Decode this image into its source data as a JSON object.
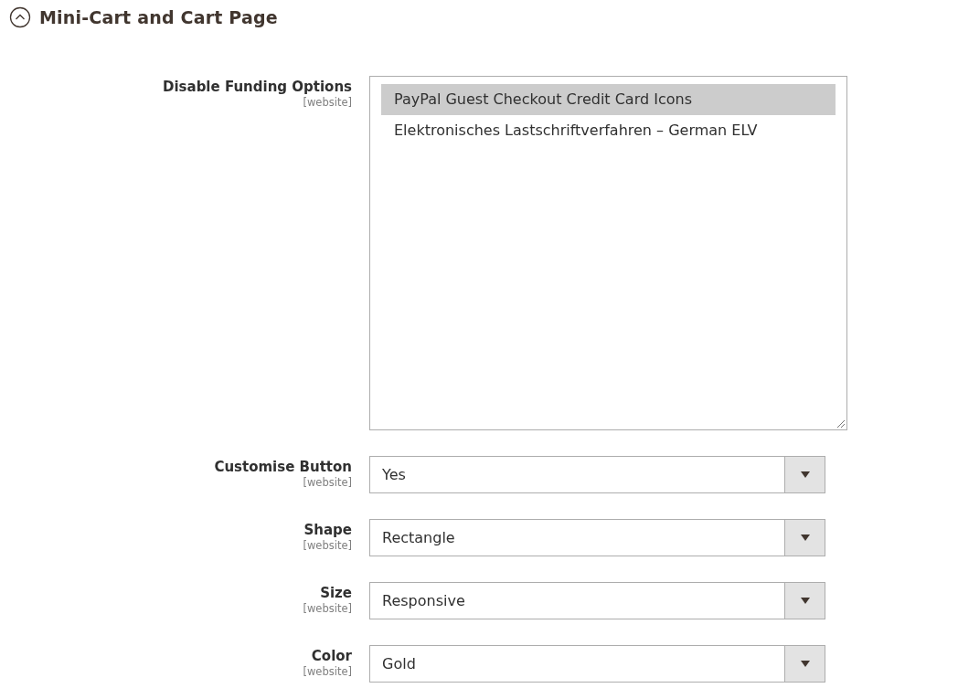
{
  "section": {
    "title": "Mini-Cart and Cart Page",
    "expanded": true
  },
  "fields": [
    {
      "kind": "multiselect",
      "label": "Disable Funding Options",
      "scope": "[website]",
      "options": [
        {
          "label": "PayPal Guest Checkout Credit Card Icons",
          "selected": true
        },
        {
          "label": "Elektronisches Lastschriftverfahren – German ELV",
          "selected": false
        }
      ]
    },
    {
      "kind": "select",
      "label": "Customise Button",
      "scope": "[website]",
      "value": "Yes"
    },
    {
      "kind": "select",
      "label": "Shape",
      "scope": "[website]",
      "value": "Rectangle"
    },
    {
      "kind": "select",
      "label": "Size",
      "scope": "[website]",
      "value": "Responsive"
    },
    {
      "kind": "select",
      "label": "Color",
      "scope": "[website]",
      "value": "Gold"
    }
  ]
}
